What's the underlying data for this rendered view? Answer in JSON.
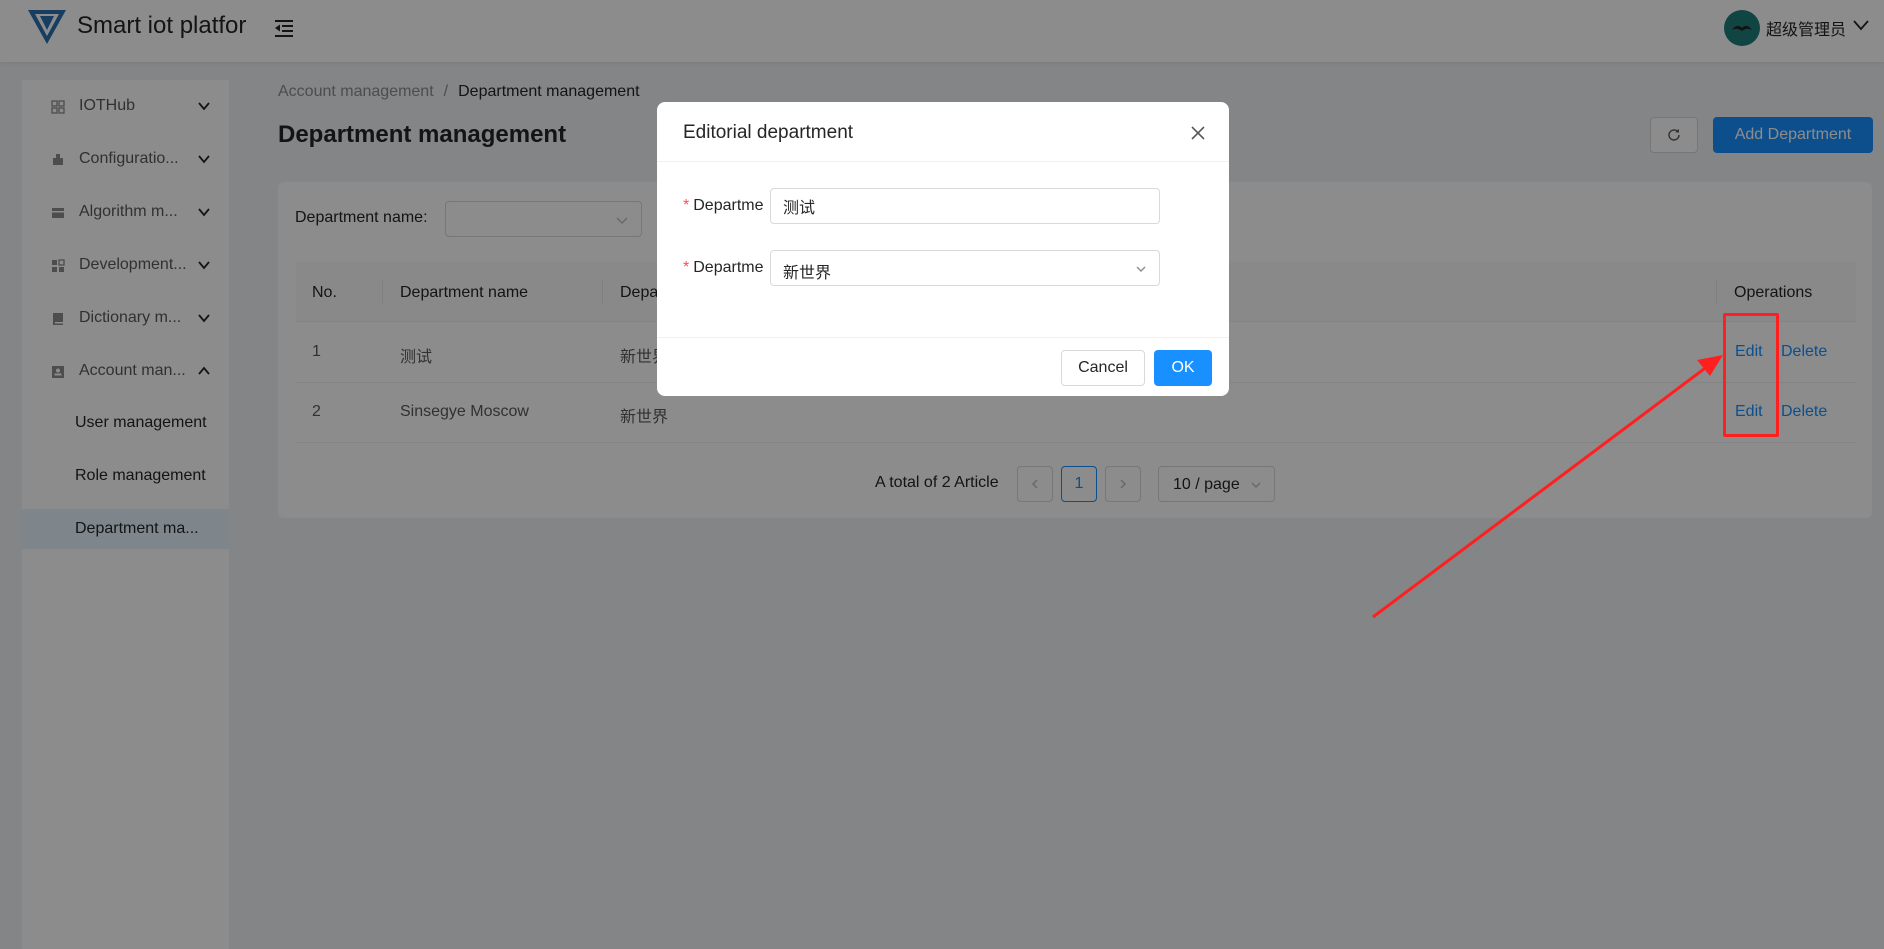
{
  "header": {
    "app_title": "Smart iot platfor",
    "username": "超级管理员"
  },
  "sidebar": {
    "items": [
      {
        "label": "IOTHub",
        "icon": "grid-icon",
        "expanded": false
      },
      {
        "label": "Configuratio...",
        "icon": "robot-icon",
        "expanded": false
      },
      {
        "label": "Algorithm m...",
        "icon": "card-icon",
        "expanded": false
      },
      {
        "label": "Development...",
        "icon": "apps-icon",
        "expanded": false
      },
      {
        "label": "Dictionary m...",
        "icon": "book-icon",
        "expanded": false
      },
      {
        "label": "Account man...",
        "icon": "idcard-icon",
        "expanded": true
      }
    ],
    "sub_items": [
      {
        "label": "User management",
        "active": false
      },
      {
        "label": "Role management",
        "active": false
      },
      {
        "label": "Department ma...",
        "active": true
      }
    ]
  },
  "breadcrumb": {
    "parent": "Account management",
    "separator": "/",
    "current": "Department management"
  },
  "page": {
    "title": "Department management",
    "add_button": "Add Department"
  },
  "filter": {
    "label": "Department name:",
    "value": ""
  },
  "table": {
    "headers": [
      "No.",
      "Department name",
      "Depa",
      "Operations"
    ],
    "rows": [
      {
        "no": "1",
        "name": "测试",
        "parent": "新世界",
        "edit": "Edit",
        "delete": "Delete"
      },
      {
        "no": "2",
        "name": "Sinsegye Moscow",
        "parent": "新世界",
        "edit": "Edit",
        "delete": "Delete"
      }
    ]
  },
  "pagination": {
    "total": "A total of 2 Article",
    "current_page": "1",
    "page_size": "10 / page"
  },
  "modal": {
    "title": "Editorial department",
    "field1_label": "Departme",
    "field1_value": "测试",
    "field2_label": "Departme",
    "field2_value": "新世界",
    "cancel": "Cancel",
    "ok": "OK"
  },
  "colors": {
    "primary": "#1890ff",
    "annotation": "#ff1f1f",
    "required": "#ff4d4f"
  }
}
